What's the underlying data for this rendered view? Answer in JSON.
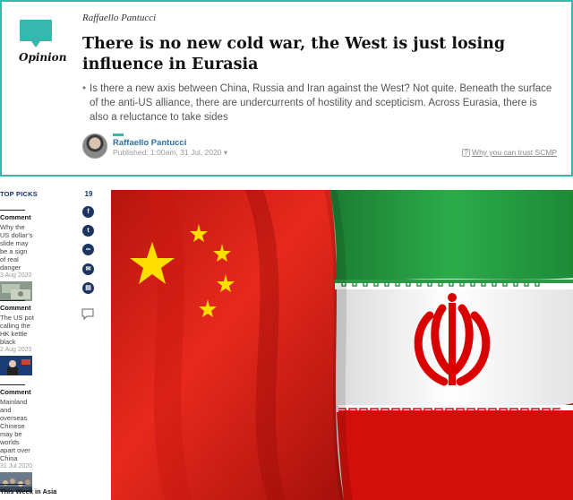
{
  "opinion": {
    "section_label": "Opinion",
    "author_top": "Raffaello Pantucci",
    "title": "There is no new cold war, the West is just losing influence in Eurasia",
    "summary": "Is there a new axis between China, Russia and Iran against the West? Not quite. Beneath the surface of the anti-US alliance, there are undercurrents of hostility and scepticism. Across Eurasia, there is also a reluctance to take sides",
    "byline_name": "Raffaello Pantucci",
    "published": "Published: 1:00am, 31 Jul, 2020",
    "trust_link": "Why you can trust SCMP",
    "accent_color": "#37b8ae"
  },
  "sidebar": {
    "title": "TOP PICKS",
    "picks": [
      {
        "category": "Comment",
        "text": "Why the US dollar’s slide may be a sign of real danger",
        "date": "3 Aug 2020"
      },
      {
        "category": "Comment",
        "text": "The US pot calling the HK kettle black",
        "date": "2 Aug 2020"
      },
      {
        "category": "Comment",
        "text": "Mainland and overseas Chinese may be worlds apart over China",
        "date": "31 Jul 2020"
      },
      {
        "category": "This Week in Asia",
        "text": "",
        "date": ""
      }
    ]
  },
  "share": {
    "count": "19",
    "icons": [
      "facebook-icon",
      "twitter-icon",
      "link-icon",
      "email-icon",
      "print-icon",
      "comment-icon"
    ]
  },
  "colors": {
    "link_blue": "#2a6fa8",
    "navy": "#1b3560",
    "china_red": "#e2231a",
    "iran_green": "#239f40",
    "iran_red": "#da0000"
  }
}
